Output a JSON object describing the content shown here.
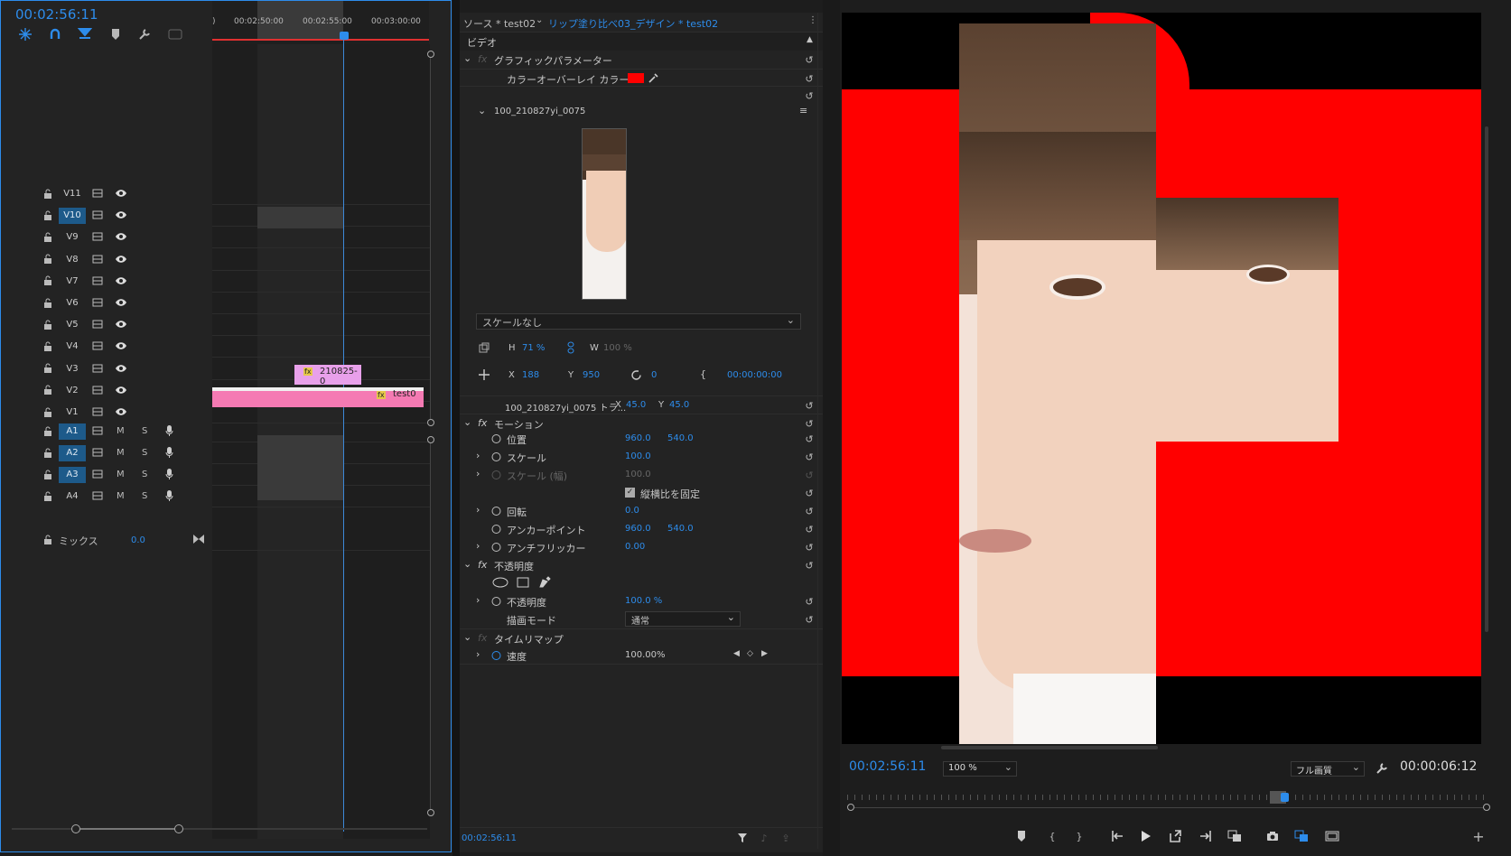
{
  "timeline": {
    "timecode": "00:02:56:11",
    "ruler_labels": [
      ")",
      "00:02:50:00",
      "00:02:55:00",
      "00:03:00:00"
    ],
    "video_tracks": [
      {
        "name": "V11",
        "selected": false
      },
      {
        "name": "V10",
        "selected": true
      },
      {
        "name": "V9",
        "selected": false
      },
      {
        "name": "V8",
        "selected": false
      },
      {
        "name": "V7",
        "selected": false
      },
      {
        "name": "V6",
        "selected": false
      },
      {
        "name": "V5",
        "selected": false
      },
      {
        "name": "V4",
        "selected": false
      },
      {
        "name": "V3",
        "selected": false
      },
      {
        "name": "V2",
        "selected": false
      },
      {
        "name": "V1",
        "selected": false
      }
    ],
    "audio_tracks": [
      {
        "name": "A1",
        "selected": true,
        "m": "M",
        "s": "S"
      },
      {
        "name": "A2",
        "selected": true,
        "m": "M",
        "s": "S"
      },
      {
        "name": "A3",
        "selected": true,
        "m": "M",
        "s": "S"
      },
      {
        "name": "A4",
        "selected": false,
        "m": "M",
        "s": "S"
      }
    ],
    "mix": {
      "label": "ミックス",
      "value": "0.0"
    },
    "clips": {
      "v3": "210825-0",
      "v2": "test0",
      "fx": "fx"
    }
  },
  "effects": {
    "tab_source": "ソース * test02",
    "tab_active": "リップ塗り比べ03_デザイン * test02",
    "section_video": "ビデオ",
    "graphic_params": "グラフィックパラメーター",
    "color_overlay_label": "カラーオーバーレイ カラー",
    "color_overlay_value": "#ff0000",
    "layer_name": "100_210827yi_0075",
    "scale_mode": "スケールなし",
    "h_label": "H",
    "h_value": "71 %",
    "w_label": "W",
    "w_value": "100 %",
    "x_label": "X",
    "x_value": "188",
    "y_label": "Y",
    "y_value": "950",
    "rot_value": "0",
    "time_value": "00:00:00:00",
    "transform_label": "100_210827yi_0075 トラ...",
    "transform_x_label": "X",
    "transform_x": "45.0",
    "transform_y_label": "Y",
    "transform_y": "45.0",
    "motion": "モーション",
    "position_label": "位置",
    "position_x": "960.0",
    "position_y": "540.0",
    "scale_label": "スケール",
    "scale_value": "100.0",
    "scale_w_label": "スケール (幅)",
    "scale_w_value": "100.0",
    "uniform_label": "縦横比を固定",
    "rotation_label": "回転",
    "rotation_value": "0.0",
    "anchor_label": "アンカーポイント",
    "anchor_x": "960.0",
    "anchor_y": "540.0",
    "antiflicker_label": "アンチフリッカー",
    "antiflicker_value": "0.00",
    "opacity_section": "不透明度",
    "opacity_label": "不透明度",
    "opacity_value": "100.0 %",
    "blend_label": "描画モード",
    "blend_value": "通常",
    "timeremap": "タイムリマップ",
    "speed_label": "速度",
    "speed_value": "100.00%",
    "footer_tc": "00:02:56:11",
    "fx_label": "fx"
  },
  "program": {
    "timecode": "00:02:56:11",
    "zoom": "100 %",
    "quality": "フル画質",
    "duration": "00:00:06:12"
  },
  "colors": {
    "accent": "#2d8ceb",
    "overlay_red": "#ff0000",
    "clip_pink": "#f57ab3",
    "clip_violet": "#e8a0ea"
  },
  "icons": [
    "snap-icon",
    "linked-selection-icon",
    "marker-icon",
    "wrench-icon",
    "caption-icon",
    "lock-icon",
    "eye-icon",
    "mic-icon",
    "reset-icon",
    "eyedropper-icon",
    "stopwatch-icon",
    "filter-icon",
    "play-icon",
    "camera-icon"
  ]
}
